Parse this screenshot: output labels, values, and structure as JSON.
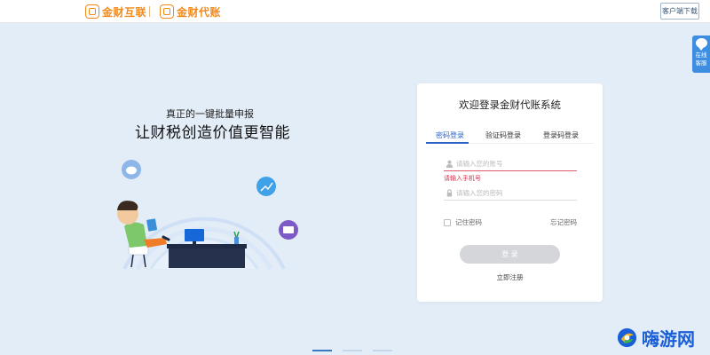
{
  "header": {
    "brand_primary": "金财互联",
    "brand_secondary": "金财代账",
    "client_download": "客户端下载"
  },
  "service": {
    "label_line1": "在线",
    "label_line2": "客服"
  },
  "hero": {
    "slogan_small": "真正的一键批量申报",
    "slogan_large": "让财税创造价值更智能"
  },
  "login": {
    "title": "欢迎登录金财代账系统",
    "tabs": [
      {
        "label": "密码登录",
        "active": true
      },
      {
        "label": "验证码登录",
        "active": false
      },
      {
        "label": "登录码登录",
        "active": false
      }
    ],
    "account_placeholder": "请输入您的账号",
    "account_error": "请输入手机号",
    "password_placeholder": "请输入您的密码",
    "remember_label": "记住密码",
    "forgot_label": "忘记密码",
    "login_button": "登 录",
    "register_link": "立即注册"
  },
  "carousel": {
    "count": 3,
    "active": 0
  },
  "watermark": {
    "text": "嗨游网"
  },
  "colors": {
    "accent": "#2b62c8",
    "brand_orange": "#f08a1c",
    "error": "#d9304a",
    "background": "#e3edf7"
  }
}
